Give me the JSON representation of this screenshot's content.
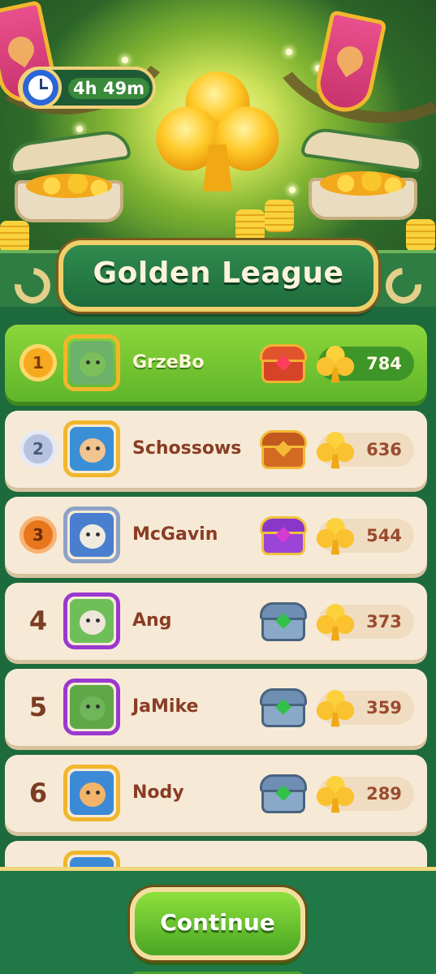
{
  "timer": {
    "label": "4h 49m"
  },
  "title": "Golden League",
  "rows": [
    {
      "rank": "1",
      "name": "GrzeBo",
      "score": "784",
      "rank_style": "gold",
      "avatar_border": "gold",
      "avatar_bg": "#6db26b",
      "avatar_head": "#7cbf5a",
      "reward": "red",
      "highlight": true
    },
    {
      "rank": "2",
      "name": "Schossows",
      "score": "636",
      "rank_style": "silver",
      "avatar_border": "gold",
      "avatar_bg": "#3a8fd6",
      "avatar_head": "#f2c48f",
      "reward": "orange",
      "highlight": false
    },
    {
      "rank": "3",
      "name": "McGavin",
      "score": "544",
      "rank_style": "bronze",
      "avatar_border": "silver",
      "avatar_bg": "#4a7fcf",
      "avatar_head": "#f0ebe0",
      "reward": "purple",
      "highlight": false
    },
    {
      "rank": "4",
      "name": "Ang",
      "score": "373",
      "rank_style": "plain",
      "avatar_border": "purple",
      "avatar_bg": "#6fbf58",
      "avatar_head": "#efe6da",
      "reward": "steel",
      "highlight": false
    },
    {
      "rank": "5",
      "name": "JaMike",
      "score": "359",
      "rank_style": "plain",
      "avatar_border": "purple",
      "avatar_bg": "#5fa848",
      "avatar_head": "#6fb55a",
      "reward": "steel",
      "highlight": false
    },
    {
      "rank": "6",
      "name": "Nody",
      "score": "289",
      "rank_style": "plain",
      "avatar_border": "gold",
      "avatar_bg": "#3c8ad6",
      "avatar_head": "#f3b46a",
      "reward": "steel",
      "highlight": false
    }
  ],
  "continue_label": "Continue",
  "colors": {
    "accent_green": "#5fb52a",
    "card": "#f6ead6",
    "name_text": "#8a3c24",
    "clover_gold": "#f9c22e"
  }
}
